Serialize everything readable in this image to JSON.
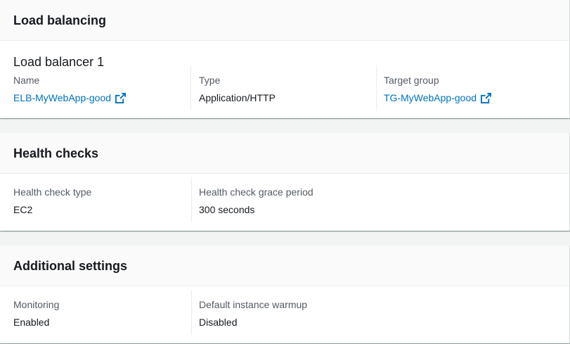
{
  "load_balancing": {
    "title": "Load balancing",
    "subheading": "Load balancer 1",
    "name_label": "Name",
    "name_value": "ELB-MyWebApp-good",
    "type_label": "Type",
    "type_value": "Application/HTTP",
    "target_group_label": "Target group",
    "target_group_value": "TG-MyWebApp-good"
  },
  "health_checks": {
    "title": "Health checks",
    "type_label": "Health check type",
    "type_value": "EC2",
    "grace_label": "Health check grace period",
    "grace_value": "300 seconds"
  },
  "additional_settings": {
    "title": "Additional settings",
    "monitoring_label": "Monitoring",
    "monitoring_value": "Enabled",
    "warmup_label": "Default instance warmup",
    "warmup_value": "Disabled"
  },
  "icons": {
    "external_link": "external-link-icon"
  },
  "colors": {
    "link": "#0073bb",
    "label": "#545b64",
    "text": "#16191f"
  }
}
